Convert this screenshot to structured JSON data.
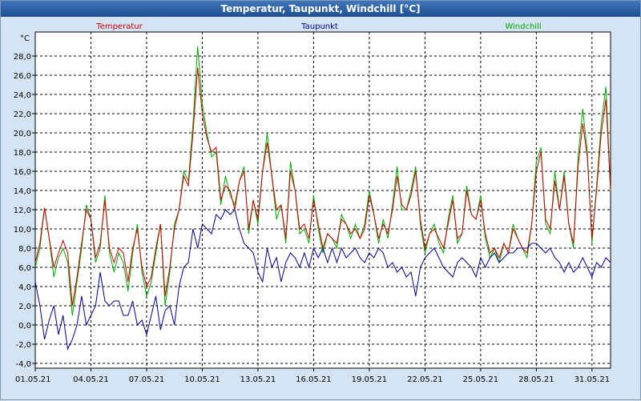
{
  "window": {
    "title": "Temperatur, Taupunkt, Windchill [°C]"
  },
  "colors": {
    "background": "#d4e4f4",
    "plot_background": "#ffffff",
    "grid": "#000000"
  },
  "chart_data": {
    "type": "line",
    "title": "Temperatur, Taupunkt, Windchill [°C]",
    "ylabel": "°C",
    "xlim": [
      0,
      31
    ],
    "ylim": [
      -4.5,
      30.5
    ],
    "grid": true,
    "legend_position": "top",
    "x_tick_values": [
      0,
      3,
      6,
      9,
      12,
      15,
      18,
      21,
      24,
      27,
      30
    ],
    "x_tick_labels": [
      "01.05.21",
      "04.05.21",
      "07.05.21",
      "10.05.21",
      "13.05.21",
      "16.05.21",
      "19.05.21",
      "22.05.21",
      "25.05.21",
      "28.05.21",
      "31.05.21"
    ],
    "y_tick_values": [
      -4,
      -2,
      0,
      2,
      4,
      6,
      8,
      10,
      12,
      14,
      16,
      18,
      20,
      22,
      24,
      26,
      28
    ],
    "y_tick_labels": [
      "-4,0",
      "-2,0",
      "0,0",
      "2,0",
      "4,0",
      "6,0",
      "8,0",
      "10,0",
      "12,0",
      "14,0",
      "16,0",
      "18,0",
      "20,0",
      "22,0",
      "24,0",
      "26,0",
      "28,0"
    ],
    "series": [
      {
        "name": "Temperatur",
        "color": "#cc0000",
        "x": [
          0,
          0.25,
          0.5,
          0.75,
          1,
          1.25,
          1.5,
          1.75,
          2,
          2.25,
          2.5,
          2.75,
          3,
          3.25,
          3.5,
          3.75,
          4,
          4.25,
          4.5,
          4.75,
          5,
          5.25,
          5.5,
          5.75,
          6,
          6.25,
          6.5,
          6.75,
          7,
          7.25,
          7.5,
          7.75,
          8,
          8.25,
          8.5,
          8.75,
          9,
          9.25,
          9.5,
          9.75,
          10,
          10.25,
          10.5,
          10.75,
          11,
          11.25,
          11.5,
          11.75,
          12,
          12.25,
          12.5,
          12.75,
          13,
          13.25,
          13.5,
          13.75,
          14,
          14.25,
          14.5,
          14.75,
          15,
          15.25,
          15.5,
          15.75,
          16,
          16.25,
          16.5,
          16.75,
          17,
          17.25,
          17.5,
          17.75,
          18,
          18.25,
          18.5,
          18.75,
          19,
          19.25,
          19.5,
          19.75,
          20,
          20.25,
          20.5,
          20.75,
          21,
          21.25,
          21.5,
          21.75,
          22,
          22.25,
          22.5,
          22.75,
          23,
          23.25,
          23.5,
          23.75,
          24,
          24.25,
          24.5,
          24.75,
          25,
          25.25,
          25.5,
          25.75,
          26,
          26.25,
          26.5,
          26.75,
          27,
          27.25,
          27.5,
          27.75,
          28,
          28.25,
          28.5,
          28.75,
          29,
          29.25,
          29.5,
          29.75,
          30,
          30.25,
          30.5,
          30.75,
          31
        ],
        "y": [
          6.5,
          8.5,
          12.2,
          9.0,
          6.0,
          7.5,
          8.8,
          7.5,
          2.0,
          5.0,
          8.5,
          12.0,
          11.0,
          7.0,
          8.5,
          13.0,
          8.0,
          6.5,
          8.0,
          7.5,
          4.5,
          8.0,
          10.0,
          6.0,
          4.0,
          5.0,
          8.0,
          10.5,
          3.0,
          6.0,
          10.0,
          12.0,
          15.5,
          14.5,
          20.0,
          26.8,
          22.0,
          19.5,
          18.0,
          18.5,
          13.0,
          14.5,
          14.0,
          12.0,
          15.0,
          16.0,
          10.0,
          13.0,
          11.0,
          16.0,
          19.0,
          15.5,
          12.0,
          12.5,
          9.0,
          16.0,
          14.0,
          10.0,
          10.5,
          9.0,
          13.0,
          10.5,
          8.0,
          9.5,
          9.0,
          8.5,
          11.0,
          10.5,
          9.5,
          10.0,
          9.0,
          10.0,
          13.5,
          11.5,
          9.0,
          10.5,
          9.5,
          12.0,
          15.5,
          12.5,
          12.0,
          13.5,
          16.0,
          11.0,
          8.0,
          9.5,
          10.0,
          9.0,
          8.0,
          10.5,
          13.0,
          9.0,
          9.5,
          14.0,
          11.5,
          11.0,
          13.0,
          9.5,
          7.5,
          8.0,
          7.0,
          8.5,
          7.5,
          10.0,
          9.0,
          8.0,
          7.5,
          10.5,
          16.0,
          18.0,
          11.0,
          10.0,
          15.0,
          12.0,
          15.5,
          10.5,
          8.5,
          16.5,
          21.0,
          17.5,
          9.0,
          14.0,
          20.0,
          23.5,
          14.0
        ]
      },
      {
        "name": "Taupunkt",
        "color": "#000099",
        "x": [
          0,
          0.25,
          0.5,
          0.75,
          1,
          1.25,
          1.5,
          1.75,
          2,
          2.25,
          2.5,
          2.75,
          3,
          3.25,
          3.5,
          3.75,
          4,
          4.25,
          4.5,
          4.75,
          5,
          5.25,
          5.5,
          5.75,
          6,
          6.25,
          6.5,
          6.75,
          7,
          7.25,
          7.5,
          7.75,
          8,
          8.25,
          8.5,
          8.75,
          9,
          9.25,
          9.5,
          9.75,
          10,
          10.25,
          10.5,
          10.75,
          11,
          11.25,
          11.5,
          11.75,
          12,
          12.25,
          12.5,
          12.75,
          13,
          13.25,
          13.5,
          13.75,
          14,
          14.25,
          14.5,
          14.75,
          15,
          15.25,
          15.5,
          15.75,
          16,
          16.25,
          16.5,
          16.75,
          17,
          17.25,
          17.5,
          17.75,
          18,
          18.25,
          18.5,
          18.75,
          19,
          19.25,
          19.5,
          19.75,
          20,
          20.25,
          20.5,
          20.75,
          21,
          21.25,
          21.5,
          21.75,
          22,
          22.25,
          22.5,
          22.75,
          23,
          23.25,
          23.5,
          23.75,
          24,
          24.25,
          24.5,
          24.75,
          25,
          25.25,
          25.5,
          25.75,
          26,
          26.25,
          26.5,
          26.75,
          27,
          27.25,
          27.5,
          27.75,
          28,
          28.25,
          28.5,
          28.75,
          29,
          29.25,
          29.5,
          29.75,
          30,
          30.25,
          30.5,
          30.75,
          31
        ],
        "y": [
          4.5,
          2.0,
          -1.5,
          0.5,
          2.0,
          -1.0,
          1.0,
          -2.5,
          -1.5,
          0.0,
          3.0,
          0.0,
          1.0,
          2.0,
          5.5,
          2.5,
          2.0,
          2.5,
          2.5,
          1.0,
          1.0,
          2.5,
          0.0,
          0.5,
          -1.0,
          1.0,
          3.0,
          -0.5,
          1.5,
          2.0,
          0.0,
          4.0,
          6.0,
          6.5,
          10.0,
          8.0,
          10.5,
          10.0,
          9.5,
          11.5,
          11.0,
          12.0,
          11.5,
          12.0,
          10.0,
          8.5,
          8.0,
          7.5,
          5.5,
          4.5,
          8.0,
          6.0,
          7.0,
          4.5,
          6.5,
          7.5,
          7.0,
          6.0,
          7.5,
          6.0,
          8.0,
          7.0,
          8.0,
          6.5,
          8.0,
          6.5,
          8.0,
          7.0,
          7.5,
          8.0,
          7.0,
          6.5,
          7.5,
          7.0,
          8.0,
          7.5,
          6.0,
          6.5,
          5.5,
          6.0,
          5.0,
          5.5,
          3.0,
          6.0,
          7.0,
          7.5,
          8.0,
          7.0,
          6.0,
          5.5,
          5.0,
          6.5,
          7.0,
          6.5,
          6.0,
          5.0,
          7.0,
          6.0,
          7.0,
          7.5,
          6.5,
          7.0,
          7.5,
          7.5,
          8.0,
          8.0,
          8.0,
          8.5,
          8.5,
          8.0,
          7.5,
          8.0,
          7.0,
          6.5,
          5.5,
          6.5,
          5.5,
          6.0,
          7.0,
          6.0,
          5.0,
          6.5,
          6.0,
          7.0,
          6.5
        ]
      },
      {
        "name": "Windchill",
        "color": "#00aa00",
        "x": [
          0,
          0.25,
          0.5,
          0.75,
          1,
          1.25,
          1.5,
          1.75,
          2,
          2.25,
          2.5,
          2.75,
          3,
          3.25,
          3.5,
          3.75,
          4,
          4.25,
          4.5,
          4.75,
          5,
          5.25,
          5.5,
          5.75,
          6,
          6.25,
          6.5,
          6.75,
          7,
          7.25,
          7.5,
          7.75,
          8,
          8.25,
          8.5,
          8.75,
          9,
          9.25,
          9.5,
          9.75,
          10,
          10.25,
          10.5,
          10.75,
          11,
          11.25,
          11.5,
          11.75,
          12,
          12.25,
          12.5,
          12.75,
          13,
          13.25,
          13.5,
          13.75,
          14,
          14.25,
          14.5,
          14.75,
          15,
          15.25,
          15.5,
          15.75,
          16,
          16.25,
          16.5,
          16.75,
          17,
          17.25,
          17.5,
          17.75,
          18,
          18.25,
          18.5,
          18.75,
          19,
          19.25,
          19.5,
          19.75,
          20,
          20.25,
          20.5,
          20.75,
          21,
          21.25,
          21.5,
          21.75,
          22,
          22.25,
          22.5,
          22.75,
          23,
          23.25,
          23.5,
          23.75,
          24,
          24.25,
          24.5,
          24.75,
          25,
          25.25,
          25.5,
          25.75,
          26,
          26.25,
          26.5,
          26.75,
          27,
          27.25,
          27.5,
          27.75,
          28,
          28.25,
          28.5,
          28.75,
          29,
          29.25,
          29.5,
          29.75,
          30,
          30.25,
          30.5,
          30.75,
          31
        ],
        "y": [
          6.0,
          8.0,
          12.2,
          9.0,
          5.0,
          7.0,
          8.0,
          6.5,
          1.0,
          4.5,
          8.0,
          12.5,
          11.0,
          6.5,
          8.0,
          13.5,
          7.5,
          5.5,
          7.5,
          6.5,
          3.5,
          7.5,
          10.5,
          5.5,
          3.0,
          4.5,
          7.5,
          10.5,
          2.0,
          5.5,
          10.5,
          12.0,
          16.0,
          15.0,
          21.0,
          29.0,
          23.0,
          20.0,
          17.5,
          18.0,
          12.5,
          15.5,
          13.5,
          12.5,
          15.0,
          16.5,
          9.5,
          13.0,
          10.5,
          16.0,
          20.0,
          15.5,
          11.0,
          12.5,
          8.5,
          17.0,
          14.0,
          9.5,
          10.0,
          8.5,
          13.5,
          10.0,
          7.5,
          9.5,
          9.0,
          8.0,
          11.5,
          10.5,
          9.0,
          10.5,
          9.0,
          10.5,
          14.0,
          11.5,
          8.5,
          11.0,
          9.0,
          12.5,
          16.5,
          12.0,
          12.0,
          14.0,
          16.5,
          10.5,
          7.5,
          9.5,
          10.5,
          8.5,
          7.5,
          11.0,
          13.5,
          8.5,
          9.5,
          14.5,
          11.5,
          11.0,
          13.5,
          9.0,
          7.0,
          8.0,
          6.5,
          8.5,
          7.5,
          10.5,
          9.0,
          8.0,
          7.0,
          10.5,
          17.0,
          18.5,
          10.5,
          9.5,
          16.0,
          12.0,
          16.0,
          10.5,
          8.0,
          17.5,
          22.5,
          18.0,
          8.5,
          14.5,
          21.0,
          24.8,
          14.0
        ]
      }
    ]
  }
}
